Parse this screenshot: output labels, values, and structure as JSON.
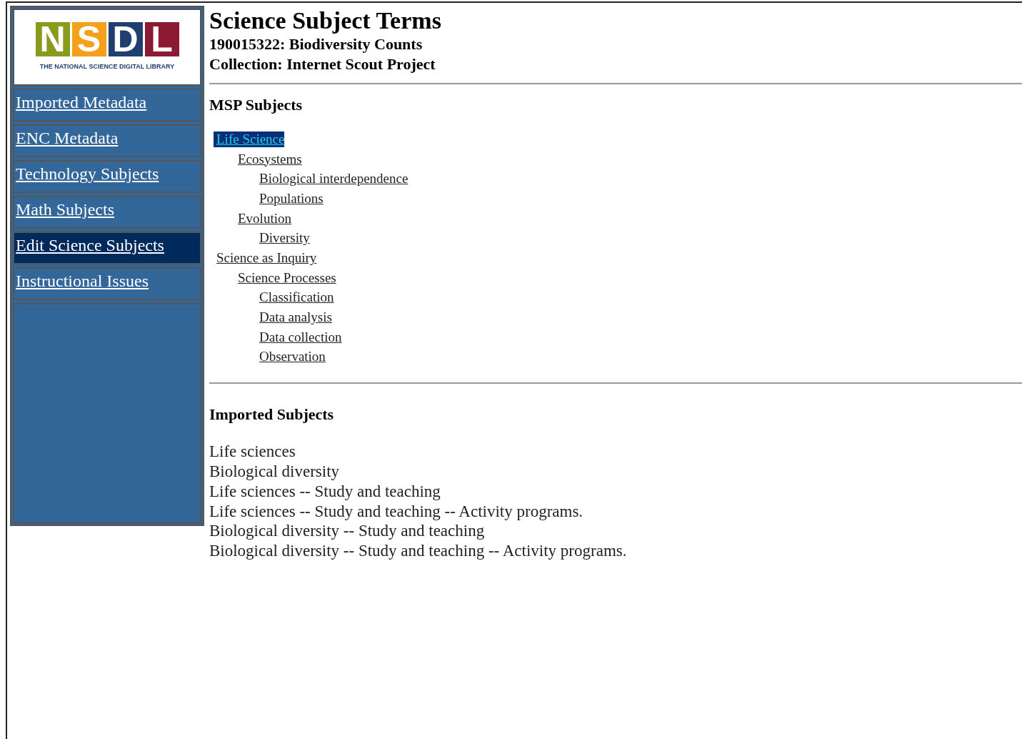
{
  "logo": {
    "letters": [
      {
        "text": "N",
        "color": "#8a9a1b"
      },
      {
        "text": "S",
        "color": "#f5a01a"
      },
      {
        "text": "D",
        "color": "#1f3f6e"
      },
      {
        "text": "L",
        "color": "#8c1a33"
      }
    ],
    "tagline": "THE NATIONAL SCIENCE DIGITAL LIBRARY"
  },
  "sidebar": {
    "items": [
      {
        "label": "Imported Metadata",
        "selected": false
      },
      {
        "label": "ENC Metadata",
        "selected": false
      },
      {
        "label": "Technology Subjects",
        "selected": false
      },
      {
        "label": "Math Subjects",
        "selected": false
      },
      {
        "label": "Edit Science Subjects",
        "selected": true
      },
      {
        "label": "Instructional Issues",
        "selected": false
      }
    ]
  },
  "header": {
    "title": "Science Subject Terms",
    "record": "190015322: Biodiversity Counts",
    "collection": "Collection: Internet Scout Project"
  },
  "msp_subjects": {
    "heading": "MSP Subjects",
    "tree": [
      {
        "label": "Life Science",
        "selected": true,
        "children": [
          {
            "label": "Ecosystems",
            "selected": false,
            "children": [
              {
                "label": "Biological interdependence",
                "selected": false
              },
              {
                "label": "Populations",
                "selected": false
              }
            ]
          },
          {
            "label": "Evolution",
            "selected": false,
            "children": [
              {
                "label": "Diversity",
                "selected": false
              }
            ]
          }
        ]
      },
      {
        "label": "Science as Inquiry",
        "selected": false,
        "children": [
          {
            "label": "Science Processes",
            "selected": false,
            "children": [
              {
                "label": "Classification",
                "selected": false
              },
              {
                "label": "Data analysis",
                "selected": false
              },
              {
                "label": "Data collection",
                "selected": false
              },
              {
                "label": "Observation",
                "selected": false
              }
            ]
          }
        ]
      }
    ]
  },
  "imported_subjects": {
    "heading": "Imported Subjects",
    "items": [
      "Life sciences",
      "Biological diversity",
      "Life sciences -- Study and teaching",
      "Life sciences -- Study and teaching -- Activity programs.",
      "Biological diversity -- Study and teaching",
      "Biological diversity -- Study and teaching -- Activity programs."
    ]
  }
}
